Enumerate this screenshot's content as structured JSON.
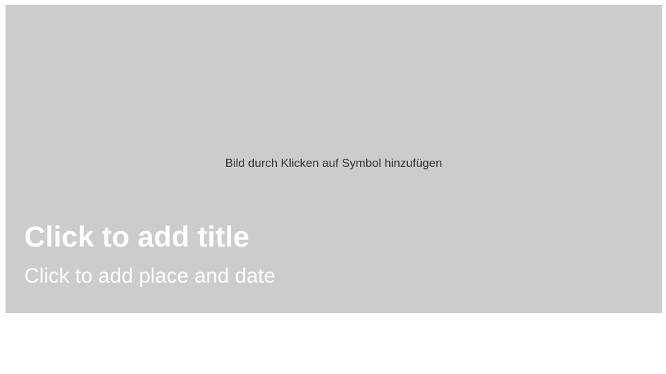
{
  "slide": {
    "image_placeholder_hint": "Bild durch Klicken auf Symbol hinzufügen",
    "title_placeholder": "Click to add title",
    "subtitle_placeholder": "Click to add place and date"
  },
  "colors": {
    "placeholder_background": "#cccccc",
    "hint_text": "#333333",
    "title_text": "#ffffff",
    "page_background": "#ffffff"
  }
}
